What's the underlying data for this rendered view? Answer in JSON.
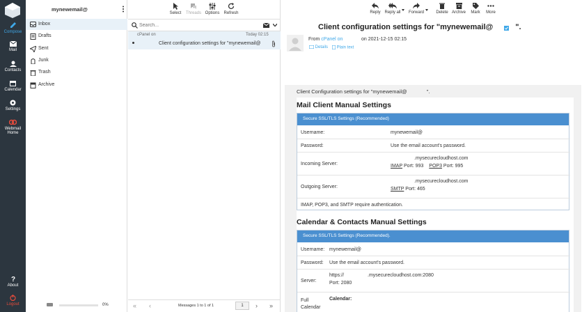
{
  "nav": {
    "compose": "Compose",
    "mail": "Mail",
    "contacts": "Contacts",
    "calendar": "Calendar",
    "settings": "Settings",
    "webmail_home_1": "Webmail",
    "webmail_home_2": "Home",
    "about": "About",
    "logout": "Logout"
  },
  "account": "mynewemail@",
  "folders": [
    "Inbox",
    "Drafts",
    "Sent",
    "Junk",
    "Trash",
    "Archive"
  ],
  "quota": "0%",
  "list_toolbar": {
    "select": "Select",
    "threads": "Threads",
    "options": "Options",
    "refresh": "Refresh"
  },
  "search": {
    "placeholder": "Search..."
  },
  "message_item": {
    "from": "cPanel on",
    "date": "Today 02:15",
    "subject": "Client configuration settings for \"mynewemail@"
  },
  "pager": {
    "text": "Messages 1 to 1 of 1",
    "page": "1"
  },
  "msg_toolbar": {
    "reply": "Reply",
    "reply_all": "Reply all",
    "forward": "Forward",
    "delete": "Delete",
    "archive": "Archive",
    "mark": "Mark",
    "more": "More"
  },
  "header": {
    "subject": "Client configuration settings for \"mynewemail@",
    "subject_end": "\".",
    "from_label": "From",
    "from_name": "cPanel",
    "from_on": "on",
    "on": "on",
    "date": "2021-12-15 02:15",
    "details": "Details",
    "plain": "Plain text"
  },
  "body": {
    "intro": "Client Configuration settings for \"mynewemail@",
    "intro_end": "\".",
    "mail_title": "Mail Client Manual Settings",
    "mail_bar": "Secure SSL/TLS Settings (Recommended)",
    "username_label": "Username:",
    "username_val": "mynewemail@",
    "password_label": "Password:",
    "password_val": "Use the email account's password.",
    "incoming_label": "Incoming Server:",
    "incoming_host": ".mysecurecloudhost.com",
    "imap": "IMAP",
    "imap_port": "Port: 993",
    "pop3": "POP3",
    "pop3_port": "Port: 995",
    "outgoing_label": "Outgoing Server:",
    "outgoing_host": ".mysecurecloudhost.com",
    "smtp": "SMTP",
    "smtp_port": "Port: 465",
    "auth_note": "IMAP, POP3, and SMTP require authentication.",
    "cal_title": "Calendar & Contacts Manual Settings",
    "cal_bar": "Secure SSL/TLS Settings (Recommended).",
    "cal_user_label": "Username:",
    "cal_user_val": "mynewemail@",
    "cal_pass_label": "Password:",
    "cal_pass_val": "Use the email account's password.",
    "server_label": "Server:",
    "server_val_a": "https://",
    "server_val_b": ".mysecurecloudhost.com:2080",
    "server_port": "Port: 2080",
    "full_cal_1": "Full",
    "full_cal_2": "Calendar",
    "calendar_label": "Calendar:"
  },
  "colors": {
    "nav_bg": "#2c363f",
    "accent": "#3fa8e8",
    "bar": "#4a8fd0"
  }
}
